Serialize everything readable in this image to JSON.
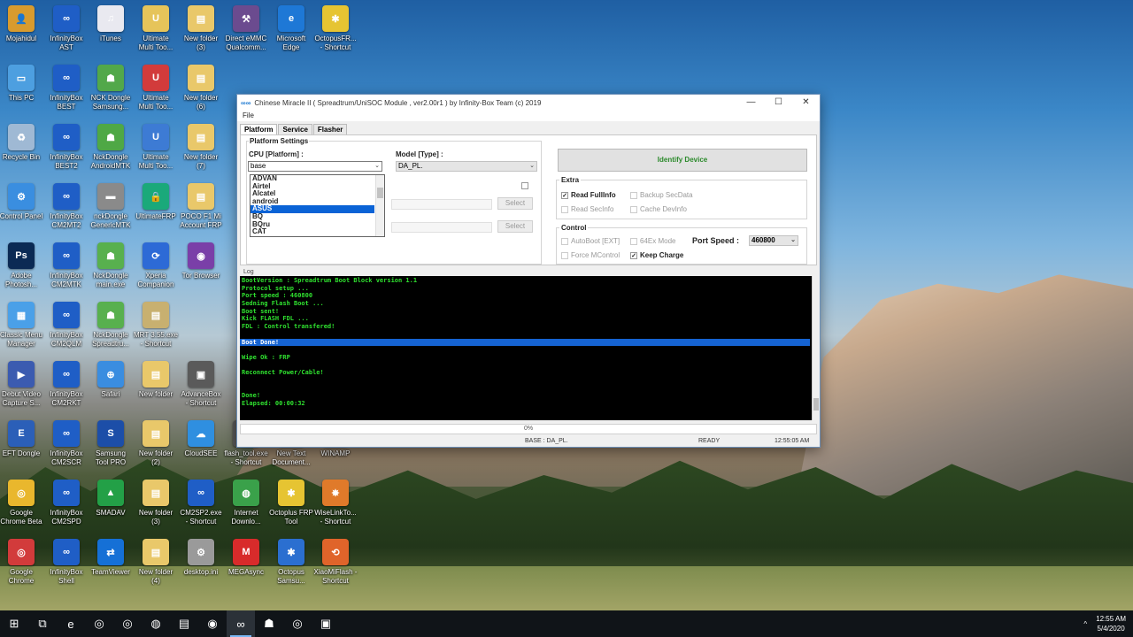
{
  "desktop": {
    "icons": [
      {
        "label": "Mojahidul",
        "color": "#d89b2e",
        "glyph": "👤"
      },
      {
        "label": "InfinityBox\nAST",
        "color": "#1f5ec6",
        "glyph": "∞"
      },
      {
        "label": "iTunes",
        "color": "#e9e9f0",
        "glyph": "♫"
      },
      {
        "label": "Ultimate\nMulti Too...",
        "color": "#e6c45a",
        "glyph": "U"
      },
      {
        "label": "New folder\n(3)",
        "color": "#e9c86a",
        "glyph": "▤"
      },
      {
        "label": "Direct eMMC\nQualcomm...",
        "color": "#6b4b8f",
        "glyph": "⚒"
      },
      {
        "label": "Microsoft\nEdge",
        "color": "#1e78d6",
        "glyph": "e"
      },
      {
        "label": "OctopusFR...\n- Shortcut",
        "color": "#e6c432",
        "glyph": "✱"
      },
      {
        "label": "This PC",
        "color": "#4d9fe0",
        "glyph": "▭"
      },
      {
        "label": "InfinityBox\nBEST",
        "color": "#1f5ec6",
        "glyph": "∞"
      },
      {
        "label": "NCK Dongle\nSamsung...",
        "color": "#52a84a",
        "glyph": "☗"
      },
      {
        "label": "Ultimate\nMulti Too...",
        "color": "#d23b3b",
        "glyph": "U"
      },
      {
        "label": "New folder\n(6)",
        "color": "#e9c86a",
        "glyph": "▤"
      },
      {
        "label": "Recycle Bin",
        "color": "#9fb9d4",
        "glyph": "♻"
      },
      {
        "label": "InfinityBox\nBEST2",
        "color": "#1f5ec6",
        "glyph": "∞"
      },
      {
        "label": "NckDongle\nAndroidMTK",
        "color": "#4fa845",
        "glyph": "☗"
      },
      {
        "label": "Ultimate\nMulti Too...",
        "color": "#3d7bd4",
        "glyph": "U"
      },
      {
        "label": "New folder\n(7)",
        "color": "#e9c86a",
        "glyph": "▤"
      },
      {
        "label": "Control Panel",
        "color": "#3a8ee0",
        "glyph": "⚙"
      },
      {
        "label": "InfinityBox\nCM2MT2",
        "color": "#1f5ec6",
        "glyph": "∞"
      },
      {
        "label": "nckDongle\nGenericMTK",
        "color": "#8a8a8a",
        "glyph": "▬"
      },
      {
        "label": "UltimateFRP",
        "color": "#1aa97a",
        "glyph": "🔒"
      },
      {
        "label": "POCO F1 Mi\nAccount FRP",
        "color": "#e9c86a",
        "glyph": "▤"
      },
      {
        "label": "Adobe\nPhotosh...",
        "color": "#0b2a54",
        "glyph": "Ps"
      },
      {
        "label": "InfinityBox\nCM2MTK",
        "color": "#1f5ec6",
        "glyph": "∞"
      },
      {
        "label": "NckDongle\nmain.exe",
        "color": "#58b04e",
        "glyph": "☗"
      },
      {
        "label": "Xperia\nCompanion",
        "color": "#2d6ad6",
        "glyph": "⟳"
      },
      {
        "label": "Tor Browser",
        "color": "#7a3fa8",
        "glyph": "◉"
      },
      {
        "label": "Classic Menu\nManager",
        "color": "#4aa0e8",
        "glyph": "▦"
      },
      {
        "label": "InfinityBox\nCM2QLM",
        "color": "#1f5ec6",
        "glyph": "∞"
      },
      {
        "label": "NckDongle\nSpreadtru...",
        "color": "#58b04e",
        "glyph": "☗"
      },
      {
        "label": "MRT 3.55.exe\n- Shortcut",
        "color": "#c8b070",
        "glyph": "▤"
      },
      {
        "label": "Debut Video\nCapture S...",
        "color": "#3b5bb0",
        "glyph": "▶"
      },
      {
        "label": "InfinityBox\nCM2RKT",
        "color": "#1f5ec6",
        "glyph": "∞"
      },
      {
        "label": "Safari",
        "color": "#3a8de0",
        "glyph": "⊕"
      },
      {
        "label": "New folder",
        "color": "#e9c86a",
        "glyph": "▤"
      },
      {
        "label": "AdvanceBox\n- Shortcut",
        "color": "#5a5a5a",
        "glyph": "▣"
      },
      {
        "label": "EFT Dongle",
        "color": "#2b5fb8",
        "glyph": "E"
      },
      {
        "label": "InfinityBox\nCM2SCR",
        "color": "#1f5ec6",
        "glyph": "∞"
      },
      {
        "label": "Samsung\nTool PRO",
        "color": "#1c4ea8",
        "glyph": "S"
      },
      {
        "label": "New folder\n(2)",
        "color": "#e9c86a",
        "glyph": "▤"
      },
      {
        "label": "CloudSEE",
        "color": "#2f8fe0",
        "glyph": "☁"
      },
      {
        "label": "flash_tool.exe\n- Shortcut",
        "color": "#5a5a5a",
        "glyph": "▤"
      },
      {
        "label": "New Text\nDocument...",
        "color": "#f4f4f4",
        "glyph": "≡"
      },
      {
        "label": "WINAMP",
        "color": "#c9a33a",
        "glyph": "⚡"
      },
      {
        "label": "Google\nChrome Beta",
        "color": "#e9b72d",
        "glyph": "◎"
      },
      {
        "label": "InfinityBox\nCM2SPD",
        "color": "#1f5ec6",
        "glyph": "∞"
      },
      {
        "label": "SMADAV",
        "color": "#23a047",
        "glyph": "▲"
      },
      {
        "label": "New folder\n(3)",
        "color": "#e9c86a",
        "glyph": "▤"
      },
      {
        "label": "CM2SP2.exe\n- Shortcut",
        "color": "#1f5ec6",
        "glyph": "∞"
      },
      {
        "label": "Internet\nDownlo...",
        "color": "#3aa14a",
        "glyph": "◍"
      },
      {
        "label": "Octoplus FRP\nTool",
        "color": "#e6c432",
        "glyph": "✱"
      },
      {
        "label": "WiseLinkTo...\n- Shortcut",
        "color": "#e07a2a",
        "glyph": "✸"
      },
      {
        "label": "Google\nChrome",
        "color": "#d23b3b",
        "glyph": "◎"
      },
      {
        "label": "InfinityBox\nShell",
        "color": "#1f5ec6",
        "glyph": "∞"
      },
      {
        "label": "TeamViewer",
        "color": "#1570d6",
        "glyph": "⇄"
      },
      {
        "label": "New folder\n(4)",
        "color": "#e9c86a",
        "glyph": "▤"
      },
      {
        "label": "desktop.ini",
        "color": "#9a9a9a",
        "glyph": "⚙"
      },
      {
        "label": "MEGAsync",
        "color": "#d82b2b",
        "glyph": "M"
      },
      {
        "label": "Octopus\nSamsu...",
        "color": "#2b6fd0",
        "glyph": "✱"
      },
      {
        "label": "XiaoMiFlash -\nShortcut",
        "color": "#e0642a",
        "glyph": "⟲"
      }
    ]
  },
  "window": {
    "icon": "∞∞",
    "title": "Chinese Miracle II ( Spreadtrum/UniSOC Module , ver2.00r1  ) by Infinity-Box Team (c) 2019",
    "controls": {
      "minimize": "—",
      "maximize": "☐",
      "close": "✕"
    },
    "menu": "File",
    "tabs": [
      "Platform",
      "Service",
      "Flasher"
    ],
    "platform_settings": {
      "title": "Platform Settings",
      "cpu_label": "CPU [Platform] :",
      "cpu_value": "base",
      "model_label": "Model [Type] :",
      "model_value": "DA_PL.",
      "cpu_options": [
        "ADVAN",
        "Airtel",
        "Alcatel",
        "android",
        "ASUS",
        "BQ",
        "BQru",
        "CAT"
      ],
      "selected_option": "ASUS",
      "select_button_1": "Select",
      "select_button_2": "Select"
    },
    "identify_button": "Identify Device",
    "extra": {
      "title": "Extra",
      "read_fullinfo": "Read FullInfo",
      "backup_secdata": "Backup SecData",
      "read_secinfo": "Read SecInfo",
      "cache_devinfo": "Cache DevInfo"
    },
    "control": {
      "title": "Control",
      "autoboot": "AutoBoot [EXT]",
      "ex64_mode": "64Ex Mode",
      "port_speed_label": "Port Speed :",
      "port_speed_value": "460800",
      "force_mcontrol": "Force MControl",
      "keep_charge": "Keep Charge"
    },
    "log_label": "Log",
    "log_lines": [
      "BootVersion : Spreadtrum Boot Block version 1.1",
      "Protocol setup ...",
      "Port speed : 460800",
      "Sedning Flash Boot ...",
      "Boot sent!",
      "Kick FLASH FDL ...",
      "FDL : Control transfered!",
      "",
      "Boot Done!",
      "",
      "Wipe Ok : FRP",
      "",
      "Reconnect Power/Cable!",
      "",
      "",
      "Done!",
      "Elapsed: 00:00:32"
    ],
    "log_highlight_index": 8,
    "progress": "0%",
    "status": {
      "base": "BASE : DA_PL.",
      "state": "READY",
      "time": "12:55:05 AM"
    }
  },
  "taskbar": {
    "items": [
      {
        "name": "start-button",
        "glyph": "⊞"
      },
      {
        "name": "task-view-button",
        "glyph": "⧉"
      },
      {
        "name": "edge-taskbar",
        "glyph": "e"
      },
      {
        "name": "chrome-taskbar",
        "glyph": "◎"
      },
      {
        "name": "chrome-beta-taskbar",
        "glyph": "◎"
      },
      {
        "name": "vpn-taskbar",
        "glyph": "◍"
      },
      {
        "name": "explorer-taskbar",
        "glyph": "▤"
      },
      {
        "name": "app-taskbar-1",
        "glyph": "◉"
      },
      {
        "name": "infinity-taskbar",
        "glyph": "∞"
      },
      {
        "name": "android-taskbar",
        "glyph": "☗"
      },
      {
        "name": "chrome-taskbar-2",
        "glyph": "◎"
      },
      {
        "name": "save-app-taskbar",
        "glyph": "▣"
      }
    ],
    "tray_chevron": "^",
    "time": "12:55 AM",
    "date": "5/4/2020"
  }
}
